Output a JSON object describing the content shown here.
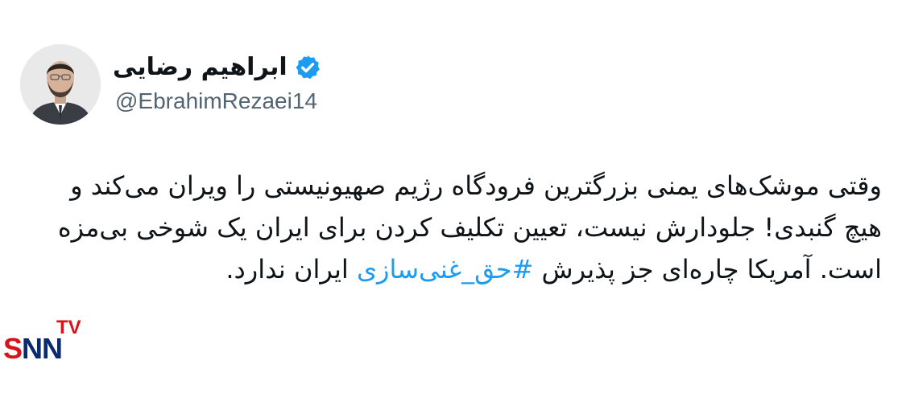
{
  "tweet": {
    "author": {
      "display_name": "ابراهیم رضایی",
      "handle": "@EbrahimRezaei14",
      "verified": true,
      "badge_icon": "verified-badge-icon",
      "badge_color": "#1d9bf0"
    },
    "text_part1": "وقتی موشک‌های یمنی بزرگترین فرودگاه رژیم صهیونیستی را ویران می‌کند و هیچ گنبدی! جلودارش نیست، تعیین تکلیف کردن برای ایران یک شوخی بی‌مزه است. آمریکا چاره‌ای جز پذیرش ",
    "hashtag": "#حق_غنی‌سازی",
    "text_part2": " ایران ندارد.",
    "hashtag_color": "#1d9bf0"
  },
  "watermark": {
    "tv": "TV",
    "s": "S",
    "nn": "NN"
  }
}
